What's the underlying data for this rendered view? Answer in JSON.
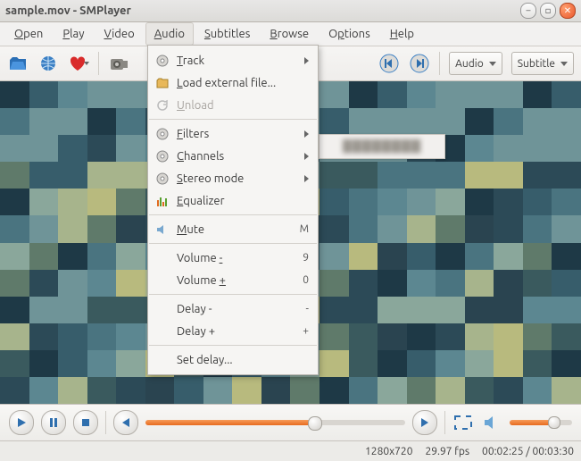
{
  "title": "sample.mov - SMPlayer",
  "menubar": [
    "Open",
    "Play",
    "Video",
    "Audio",
    "Subtitles",
    "Browse",
    "Options",
    "Help"
  ],
  "menubar_mn": [
    "O",
    "P",
    "V",
    "A",
    "S",
    "B",
    "p",
    "H"
  ],
  "active_menu_index": 3,
  "audio_menu": {
    "track": "Track",
    "load": "Load external file...",
    "unload": "Unload",
    "filters": "Filters",
    "channels": "Channels",
    "stereo": "Stereo mode",
    "equalizer": "Equalizer",
    "mute": "Mute",
    "mute_key": "M",
    "vol_dn": "Volume -",
    "vol_dn_key": "9",
    "vol_up": "Volume +",
    "vol_up_key": "0",
    "delay_dn": "Delay -",
    "delay_dn_key": "-",
    "delay_up": "Delay +",
    "delay_up_key": "+",
    "set_delay": "Set delay..."
  },
  "toolbar_buttons": {
    "audio": "Audio",
    "subtitle": "Subtitle"
  },
  "status": {
    "res": "1280x720",
    "fps": "29.97 fps",
    "curr": "00:02:25",
    "total": "00:03:30"
  }
}
